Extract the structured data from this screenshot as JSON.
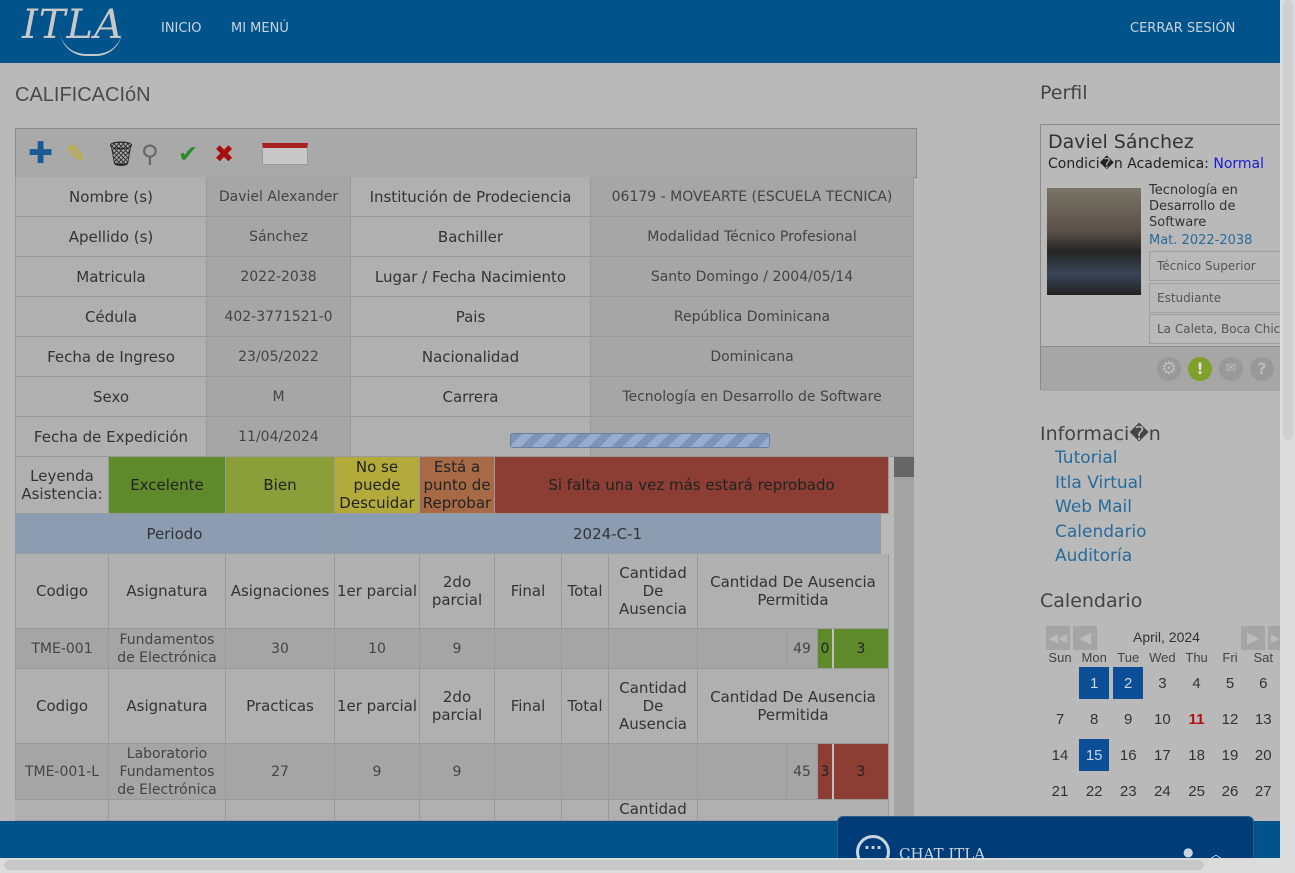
{
  "header": {
    "logo": "ITLA",
    "nav": [
      "INICIO",
      "MI MENÚ"
    ],
    "logout": "CERRAR SESIÓN"
  },
  "page_title": "CALIFICACIóN",
  "toolbar": {
    "icons": [
      "plus-icon",
      "pencil-icon",
      "trash-icon",
      "search-icon",
      "check-icon",
      "x-icon",
      "pdf-icon"
    ]
  },
  "student_info": [
    [
      "Nombre (s)",
      "Daviel Alexander",
      "Institución de Prodeciencia",
      "06179 - MOVEARTE (ESCUELA TECNICA)"
    ],
    [
      "Apellido (s)",
      "Sánchez",
      "Bachiller",
      "Modalidad Técnico Profesional"
    ],
    [
      "Matricula",
      "2022-2038",
      "Lugar / Fecha Nacimiento",
      "Santo Domingo / 2004/05/14"
    ],
    [
      "Cédula",
      "402-3771521-0",
      "Pais",
      "República Dominicana"
    ],
    [
      "Fecha de Ingreso",
      "23/05/2022",
      "Nacionalidad",
      "Dominicana"
    ],
    [
      "Sexo",
      "M",
      "Carrera",
      "Tecnología en Desarrollo de Software"
    ],
    [
      "Fecha de Expedición",
      "11/04/2024",
      "",
      ""
    ]
  ],
  "loading_progress": 100,
  "legend": {
    "label": "Leyenda Asistencia:",
    "items": [
      {
        "text": "Excelente",
        "color": "#5f8a2c"
      },
      {
        "text": "Bien",
        "color": "#8a9e3a"
      },
      {
        "text": "No se puede Descuidar",
        "color": "#b3aa3c"
      },
      {
        "text": "Está a punto de Reprobar",
        "color": "#a86a46"
      },
      {
        "text": "Si falta una vez más estará reprobado",
        "color": "#8c3e34"
      }
    ]
  },
  "period": {
    "label": "Periodo",
    "value": "2024-C-1"
  },
  "headers1": [
    "Codigo",
    "Asignatura",
    "Asignaciones",
    "1er parcial",
    "2do parcial",
    "Final",
    "Total",
    "Cantidad De Ausencia",
    "Cantidad De Ausencia Permitida"
  ],
  "headers2": [
    "Codigo",
    "Asignatura",
    "Practicas",
    "1er parcial",
    "2do parcial",
    "Final",
    "Total",
    "Cantidad De Ausencia",
    "Cantidad De Ausencia Permitida"
  ],
  "headers3_partial": "Cantidad",
  "rows": [
    {
      "code": "TME-001",
      "subject": "Fundamentos de Electrónica",
      "assign": "30",
      "p1": "10",
      "p2": "9",
      "final": "",
      "total": "",
      "absences": "",
      "blank": "",
      "score": "49",
      "abs": "0",
      "allowed": "3",
      "color": "#5f8a2c"
    },
    {
      "code": "TME-001-L",
      "subject": "Laboratorio Fundamentos de Electrónica",
      "assign": "27",
      "p1": "9",
      "p2": "9",
      "final": "",
      "total": "",
      "absences": "",
      "blank": "",
      "score": "45",
      "abs": "3",
      "allowed": "3",
      "color": "#8c3e34"
    }
  ],
  "profile": {
    "heading": "Perfil",
    "name": "Daviel Sánchez",
    "condition_label": "Condici�n Academica:",
    "condition": "Normal",
    "career": "Tecnología en Desarrollo de Software",
    "mat": "Mat. 2022-2038",
    "fields": [
      "Técnico Superior",
      "Estudiante",
      "La Caleta, Boca Chica"
    ],
    "icons": [
      "gear-icon",
      "alert-icon",
      "mail-icon",
      "help-icon"
    ]
  },
  "info": {
    "heading": "Informaci�n",
    "links": [
      "Tutorial",
      "Itla Virtual",
      "Web Mail",
      "Calendario",
      "Auditoría"
    ]
  },
  "calendar": {
    "heading": "Calendario",
    "month": "April, 2024",
    "days": [
      "Sun",
      "Mon",
      "Tue",
      "Wed",
      "Thu",
      "Fri",
      "Sat"
    ],
    "weeks": [
      [
        "",
        "1",
        "2",
        "3",
        "4",
        "5",
        "6"
      ],
      [
        "7",
        "8",
        "9",
        "10",
        "11",
        "12",
        "13"
      ],
      [
        "14",
        "15",
        "16",
        "17",
        "18",
        "19",
        "20"
      ],
      [
        "21",
        "22",
        "23",
        "24",
        "25",
        "26",
        "27"
      ]
    ],
    "selected": [
      "1",
      "2",
      "15"
    ],
    "today": "11"
  },
  "chat": {
    "title": "CHAT ITLA"
  }
}
